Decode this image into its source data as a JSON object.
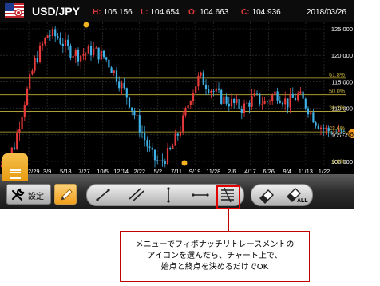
{
  "header": {
    "pair": "USD/JPY",
    "high_key": "H:",
    "high": "105.156",
    "low_key": "L:",
    "low": "104.654",
    "open_key": "O:",
    "open": "104.663",
    "close_key": "C:",
    "close": "104.936",
    "date": "2018/03/26"
  },
  "chart": {
    "y_ticks": [
      "125.000",
      "120.000",
      "115.000",
      "110.000",
      "105.000",
      "100.000"
    ],
    "x_ticks": [
      "2012/29",
      "3/9",
      "5/18",
      "7/27",
      "10/5",
      "12/14",
      "2/22",
      "5/2",
      "7/11",
      "9/19",
      "11/28",
      "2/6",
      "4/17",
      "6/26",
      "9/4",
      "11/13",
      "1/22"
    ],
    "fib_labels": [
      "61.8%",
      "50.0%",
      "38.2%",
      "23.6%",
      "0.0%"
    ],
    "current_price": "104.936",
    "colors": {
      "up": "#e83a3a",
      "down": "#3fb1e6",
      "fib_line": "#c8b43c",
      "grid": "#3a3a3a",
      "price_tag": "#f29b1a"
    }
  },
  "toolbar": {
    "settings_label": "設定",
    "eraser_all_label": "ALL",
    "icons": [
      "wrench-icon",
      "pencil-icon",
      "trendline-icon",
      "channel-icon",
      "vertical-line-icon",
      "horizontal-line-icon",
      "fibonacci-icon",
      "eraser-icon",
      "eraser-all-icon"
    ]
  },
  "callout": {
    "line1": "メニューでフィボナッチリトレースメントの",
    "line2": "アイコンを選んだら、チャート上で、",
    "line3": "始点と終点を決めるだけでOK"
  }
}
